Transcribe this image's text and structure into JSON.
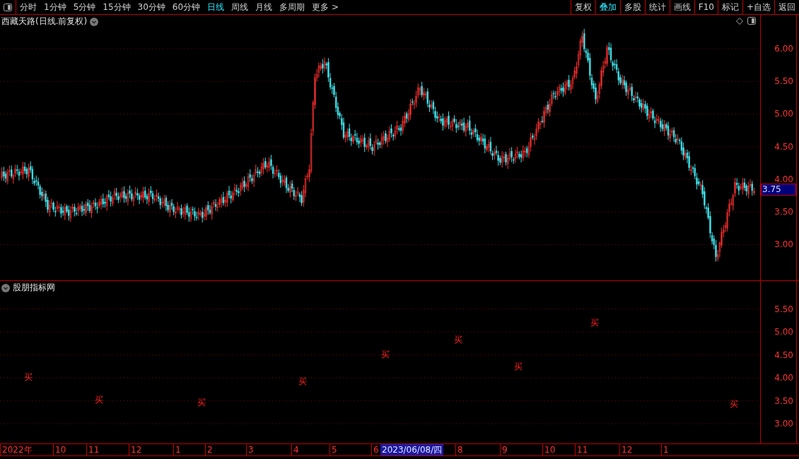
{
  "toolbar": {
    "periods": [
      {
        "label": "分时",
        "selected": false
      },
      {
        "label": "1分钟",
        "selected": false
      },
      {
        "label": "5分钟",
        "selected": false
      },
      {
        "label": "15分钟",
        "selected": false
      },
      {
        "label": "30分钟",
        "selected": false
      },
      {
        "label": "60分钟",
        "selected": false
      },
      {
        "label": "日线",
        "selected": true
      },
      {
        "label": "周线",
        "selected": false
      },
      {
        "label": "月线",
        "selected": false
      },
      {
        "label": "多周期",
        "selected": false
      },
      {
        "label": "更多 >",
        "selected": false
      }
    ],
    "actions": [
      {
        "label": "复权",
        "selected": false
      },
      {
        "label": "叠加",
        "selected": true
      },
      {
        "label": "多股",
        "selected": false
      },
      {
        "label": "统计",
        "selected": false
      },
      {
        "label": "画线",
        "selected": false
      },
      {
        "label": "F10",
        "selected": false
      },
      {
        "label": "标记",
        "selected": false
      },
      {
        "label": "+自选",
        "selected": false
      },
      {
        "label": "返回",
        "selected": false
      }
    ]
  },
  "price_panel": {
    "title": "西藏天路(日线.前复权)",
    "axis_labels": [
      "6.00",
      "5.50",
      "5.00",
      "4.50",
      "4.00",
      "3.50",
      "3.00"
    ],
    "last_price": "3.75"
  },
  "indicator_panel": {
    "title": "股朋指标网",
    "signals": [
      "买",
      "买",
      "买",
      "买",
      "买",
      "买",
      "买",
      "买",
      "买"
    ],
    "axis_labels": [
      "5.50",
      "5.00",
      "4.50",
      "4.00",
      "3.50",
      "3.00"
    ],
    "date_axis": {
      "labels": [
        "2022年",
        "10",
        "11",
        "12",
        "1",
        "2",
        "3",
        "4",
        "5",
        "6",
        "8",
        "9",
        "10",
        "11",
        "12",
        "1"
      ],
      "cursor": "2023/06/08/四"
    }
  }
}
